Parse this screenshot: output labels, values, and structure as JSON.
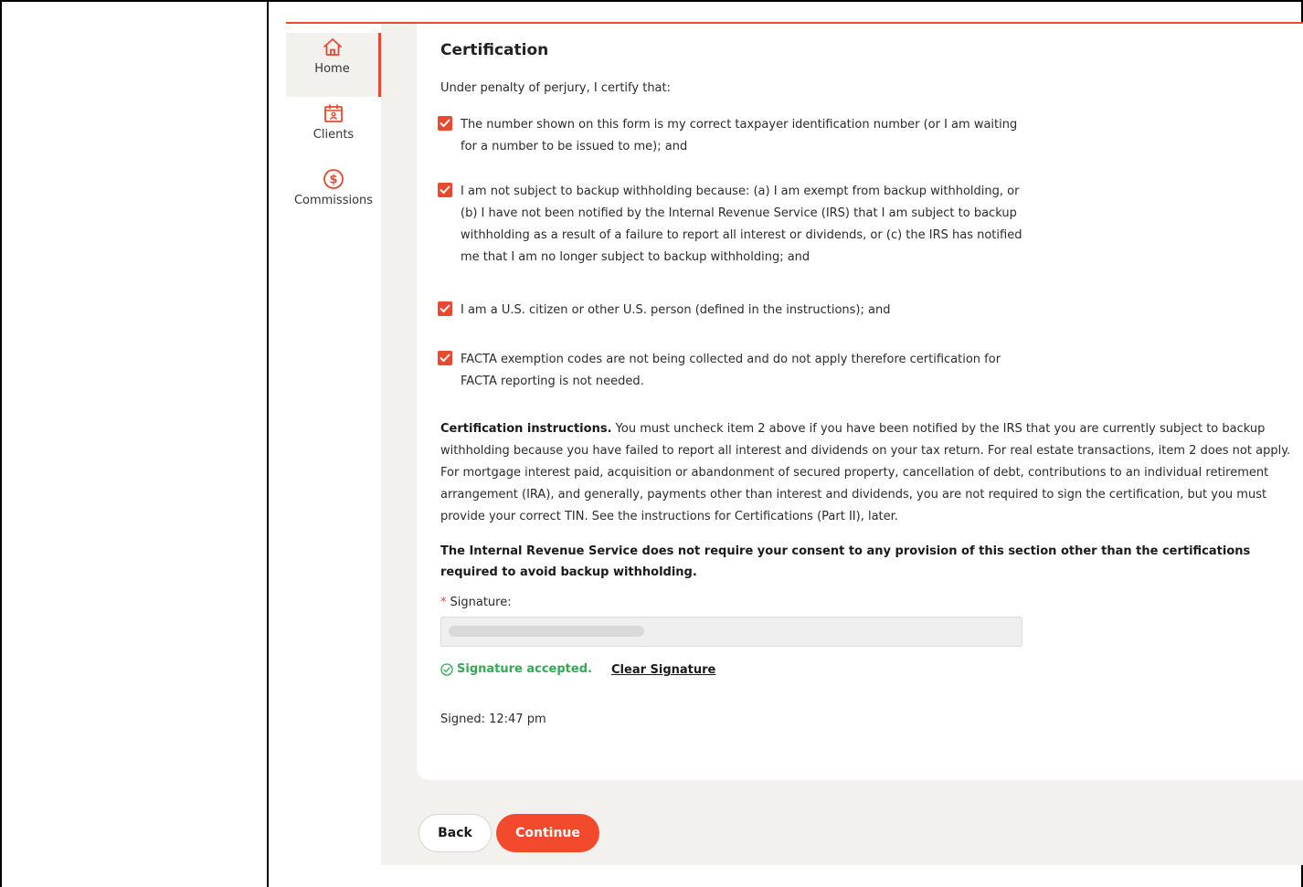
{
  "sidebar": {
    "items": [
      {
        "label": "Home",
        "icon": "home-icon"
      },
      {
        "label": "Clients",
        "icon": "clients-calendar-icon"
      },
      {
        "label": "Commissions",
        "icon": "dollar-circle-icon"
      }
    ]
  },
  "certification": {
    "title": "Certification",
    "intro": "Under penalty of perjury, I certify that:",
    "items": [
      "The number shown on this form is my correct taxpayer identification number (or I am waiting for a number to be issued to me); and",
      "I am not subject to backup withholding because: (a) I am exempt from backup withholding, or (b) I have not been notified by the Internal Revenue Service (IRS) that I am subject to backup withholding as a result of a failure to report all interest or dividends, or (c) the IRS has notified me that I am no longer subject to backup withholding; and",
      "I am a U.S. citizen or other U.S. person (defined in the instructions); and",
      "FACTA exemption codes are not being collected and do not apply therefore certification for FACTA reporting is not needed."
    ],
    "instructions_lead": "Certification instructions.",
    "instructions_body": " You must uncheck item 2 above if you have been notified by the IRS that you are currently subject to backup withholding because you have failed to report all interest and dividends on your tax return. For real estate transactions, item 2 does not apply. For mortgage interest paid, acquisition or abandonment of secured property, cancellation of debt, contributions to an individual retirement arrangement (IRA), and generally, payments other than interest and dividends, you are not required to sign the certification, but you must provide your correct TIN. See the instructions for Certifications (Part II), later.",
    "irs_note": "The Internal Revenue Service does not require your consent to any provision of this section other than the certifications required to avoid backup withholding.",
    "signature_required_mark": "*",
    "signature_label": "Signature:",
    "signature_accepted": "Signature accepted.",
    "clear_signature": "Clear Signature",
    "signed": "Signed: 12:47 pm"
  },
  "actions": {
    "back": "Back",
    "continue": "Continue"
  },
  "colors": {
    "accent": "#e8492f",
    "success": "#34a853",
    "panel_bg": "#f3f1ee"
  }
}
